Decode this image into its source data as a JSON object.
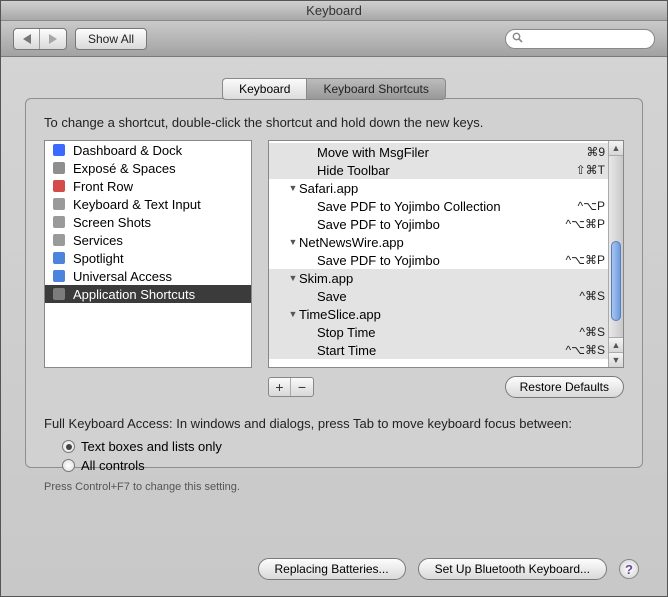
{
  "window_title": "Keyboard",
  "toolbar": {
    "show_all": "Show All",
    "search_placeholder": ""
  },
  "tabs": [
    {
      "label": "Keyboard",
      "active": false
    },
    {
      "label": "Keyboard Shortcuts",
      "active": true
    }
  ],
  "instruction": "To change a shortcut, double-click the shortcut and hold down the new keys.",
  "sidebar": {
    "items": [
      {
        "label": "Dashboard & Dock",
        "icon": "dashboard-icon",
        "color": "#1a4fff"
      },
      {
        "label": "Exposé & Spaces",
        "icon": "expose-icon",
        "color": "#7a7a7a"
      },
      {
        "label": "Front Row",
        "icon": "frontrow-icon",
        "color": "#cc2b2b"
      },
      {
        "label": "Keyboard & Text Input",
        "icon": "keyboard-icon",
        "color": "#888"
      },
      {
        "label": "Screen Shots",
        "icon": "screenshot-icon",
        "color": "#888"
      },
      {
        "label": "Services",
        "icon": "services-icon",
        "color": "#888"
      },
      {
        "label": "Spotlight",
        "icon": "spotlight-icon",
        "color": "#2a6fd6"
      },
      {
        "label": "Universal Access",
        "icon": "universal-icon",
        "color": "#2a6fd6"
      },
      {
        "label": "Application Shortcuts",
        "icon": "appshortcuts-icon",
        "color": "#888",
        "selected": true
      }
    ]
  },
  "tree": [
    {
      "depth": 2,
      "label": "Move with MsgFiler",
      "shortcut": "⌘9",
      "group": false,
      "zone": "dim"
    },
    {
      "depth": 2,
      "label": "Hide Toolbar",
      "shortcut": "⇧⌘T",
      "group": false,
      "zone": "dim"
    },
    {
      "depth": 1,
      "label": "Safari.app",
      "shortcut": "",
      "group": true,
      "zone": "hl"
    },
    {
      "depth": 2,
      "label": "Save PDF to Yojimbo Collection",
      "shortcut": "^⌥P",
      "group": false,
      "zone": "hl"
    },
    {
      "depth": 2,
      "label": "Save PDF to Yojimbo",
      "shortcut": "^⌥⌘P",
      "group": false,
      "zone": "hl"
    },
    {
      "depth": 1,
      "label": "NetNewsWire.app",
      "shortcut": "",
      "group": true,
      "zone": "hl"
    },
    {
      "depth": 2,
      "label": "Save PDF to Yojimbo",
      "shortcut": "^⌥⌘P",
      "group": false,
      "zone": "hl"
    },
    {
      "depth": 1,
      "label": "Skim.app",
      "shortcut": "",
      "group": true,
      "zone": "dim"
    },
    {
      "depth": 2,
      "label": "Save",
      "shortcut": "^⌘S",
      "group": false,
      "zone": "dim"
    },
    {
      "depth": 1,
      "label": "TimeSlice.app",
      "shortcut": "",
      "group": true,
      "zone": "dim"
    },
    {
      "depth": 2,
      "label": "Stop Time",
      "shortcut": "^⌘S",
      "group": false,
      "zone": "dim"
    },
    {
      "depth": 2,
      "label": "Start Time",
      "shortcut": "^⌥⌘S",
      "group": false,
      "zone": "dim"
    }
  ],
  "controls": {
    "restore_defaults": "Restore Defaults"
  },
  "fka": {
    "heading": "Full Keyboard Access: In windows and dialogs, press Tab to move keyboard focus between:",
    "options": [
      {
        "label": "Text boxes and lists only",
        "checked": true
      },
      {
        "label": "All controls",
        "checked": false
      }
    ],
    "hint": "Press Control+F7 to change this setting."
  },
  "footer": {
    "replacing": "Replacing Batteries...",
    "bluetooth": "Set Up Bluetooth Keyboard..."
  }
}
